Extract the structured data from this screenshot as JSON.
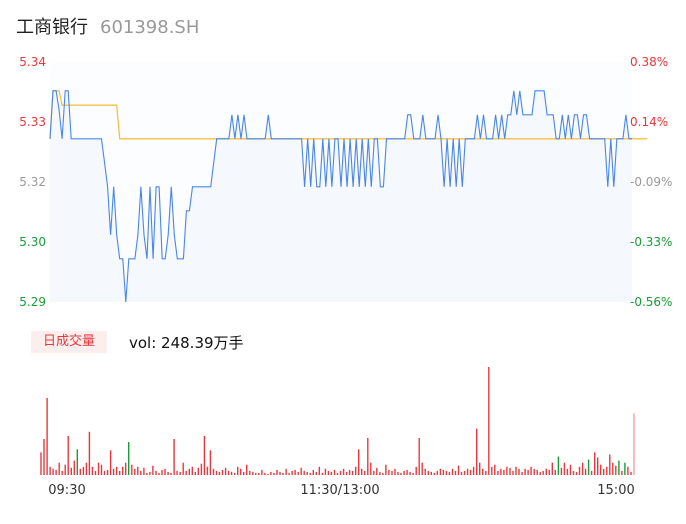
{
  "header": {
    "name": "工商银行",
    "code": "601398.SH"
  },
  "volume_panel": {
    "badge": "日成交量",
    "vol_label": "vol: 248.39万手"
  },
  "colors": {
    "up": "#e8383d",
    "down": "#1a9b3a",
    "neutral": "#999999",
    "price_line": "#4a86e8",
    "avg_line": "#f5c04a",
    "area_fill": "#f5f8fd"
  },
  "chart_data": [
    {
      "type": "line",
      "y_left_ticks": [
        "5.34",
        "5.33",
        "5.32",
        "5.30",
        "5.29"
      ],
      "y_right_ticks": [
        "0.38%",
        "0.14%",
        "-0.09%",
        "-0.33%",
        "-0.56%"
      ],
      "ylim": [
        5.29,
        5.34
      ],
      "x_ticks": [
        "09:30",
        "11:30/13:00",
        "15:00"
      ],
      "prev_close": 5.324,
      "series": [
        {
          "values": [
            5.324,
            5.334,
            5.334,
            5.33,
            5.324,
            5.334,
            5.334,
            5.324,
            5.324,
            5.324,
            5.324,
            5.324,
            5.324,
            5.324,
            5.324,
            5.324,
            5.324,
            5.324,
            5.319,
            5.314,
            5.304,
            5.314,
            5.304,
            5.299,
            5.299,
            5.29,
            5.299,
            5.299,
            5.299,
            5.304,
            5.314,
            5.304,
            5.299,
            5.314,
            5.299,
            5.314,
            5.314,
            5.299,
            5.299,
            5.304,
            5.314,
            5.304,
            5.299,
            5.299,
            5.299,
            5.309,
            5.309,
            5.314,
            5.314,
            5.314,
            5.314,
            5.314,
            5.314,
            5.314,
            5.319,
            5.324,
            5.324,
            5.324,
            5.324,
            5.324,
            5.329,
            5.324,
            5.329,
            5.324,
            5.329,
            5.324,
            5.324,
            5.324,
            5.324,
            5.324,
            5.324,
            5.324,
            5.329,
            5.324,
            5.324,
            5.324,
            5.324,
            5.324,
            5.324,
            5.324,
            5.324,
            5.324,
            5.324,
            5.324,
            5.314,
            5.324,
            5.314,
            5.324,
            5.314,
            5.314,
            5.324,
            5.314,
            5.324,
            5.314,
            5.324,
            5.324,
            5.314,
            5.324,
            5.314,
            5.324,
            5.314,
            5.324,
            5.314,
            5.324,
            5.314,
            5.324,
            5.314,
            5.324,
            5.324,
            5.314,
            5.314,
            5.324,
            5.324,
            5.324,
            5.324,
            5.324,
            5.324,
            5.324,
            5.329,
            5.329,
            5.324,
            5.324,
            5.324,
            5.329,
            5.324,
            5.324,
            5.324,
            5.324,
            5.329,
            5.324,
            5.314,
            5.324,
            5.314,
            5.324,
            5.314,
            5.324,
            5.314,
            5.324,
            5.324,
            5.324,
            5.324,
            5.329,
            5.324,
            5.329,
            5.324,
            5.324,
            5.324,
            5.329,
            5.324,
            5.329,
            5.324,
            5.329,
            5.329,
            5.334,
            5.329,
            5.334,
            5.329,
            5.329,
            5.329,
            5.329,
            5.334,
            5.334,
            5.334,
            5.334,
            5.329,
            5.329,
            5.329,
            5.324,
            5.324,
            5.329,
            5.324,
            5.329,
            5.324,
            5.329,
            5.329,
            5.324,
            5.329,
            5.329,
            5.324,
            5.324,
            5.324,
            5.324,
            5.324,
            5.324,
            5.314,
            5.324,
            5.314,
            5.324,
            5.324,
            5.324,
            5.329,
            5.324,
            5.324
          ]
        },
        {
          "values": [
            5.324,
            5.334,
            5.334,
            5.334,
            5.331,
            5.331,
            5.331,
            5.331,
            5.331,
            5.331,
            5.331,
            5.331,
            5.331,
            5.331,
            5.331,
            5.331,
            5.331,
            5.331,
            5.331,
            5.331,
            5.331,
            5.331,
            5.331,
            5.324,
            5.324,
            5.324,
            5.324,
            5.324,
            5.324,
            5.324,
            5.324,
            5.324,
            5.324,
            5.324,
            5.324,
            5.324,
            5.324,
            5.324,
            5.324,
            5.324,
            5.324,
            5.324,
            5.324,
            5.324,
            5.324,
            5.324,
            5.324,
            5.324,
            5.324,
            5.324,
            5.324,
            5.324,
            5.324,
            5.324,
            5.324,
            5.324,
            5.324,
            5.324,
            5.324,
            5.324,
            5.324,
            5.324,
            5.324,
            5.324,
            5.324,
            5.324,
            5.324,
            5.324,
            5.324,
            5.324,
            5.324,
            5.324,
            5.324,
            5.324,
            5.324,
            5.324,
            5.324,
            5.324,
            5.324,
            5.324,
            5.324,
            5.324,
            5.324,
            5.324,
            5.324,
            5.324,
            5.324,
            5.324,
            5.324,
            5.324,
            5.324,
            5.324,
            5.324,
            5.324,
            5.324,
            5.324,
            5.324,
            5.324,
            5.324,
            5.324,
            5.324,
            5.324,
            5.324,
            5.324,
            5.324,
            5.324,
            5.324,
            5.324,
            5.324,
            5.324,
            5.324,
            5.324,
            5.324,
            5.324,
            5.324,
            5.324,
            5.324,
            5.324,
            5.324,
            5.324,
            5.324,
            5.324,
            5.324,
            5.324,
            5.324,
            5.324,
            5.324,
            5.324,
            5.324,
            5.324,
            5.324,
            5.324,
            5.324,
            5.324,
            5.324,
            5.324,
            5.324,
            5.324,
            5.324,
            5.324,
            5.324,
            5.324,
            5.324,
            5.324,
            5.324,
            5.324,
            5.324,
            5.324,
            5.324,
            5.324,
            5.324,
            5.324,
            5.324,
            5.324,
            5.324,
            5.324,
            5.324,
            5.324,
            5.324,
            5.324,
            5.324,
            5.324,
            5.324,
            5.324,
            5.324,
            5.324,
            5.324,
            5.324,
            5.324,
            5.324,
            5.324,
            5.324,
            5.324,
            5.324,
            5.324,
            5.324,
            5.324,
            5.324,
            5.324,
            5.324,
            5.324,
            5.324,
            5.324,
            5.324,
            5.324,
            5.324,
            5.324,
            5.324,
            5.324,
            5.324,
            5.324,
            5.324,
            5.324,
            5.324,
            5.324,
            5.324,
            5.324,
            5.324
          ]
        }
      ]
    },
    {
      "type": "bar",
      "series": [
        {
          "values": [
            22,
            35,
            75,
            8,
            6,
            5,
            12,
            4,
            10,
            38,
            7,
            14,
            34,
            6,
            8,
            12,
            42,
            8,
            4,
            12,
            10,
            4,
            5,
            24,
            6,
            8,
            4,
            8,
            12,
            14,
            10,
            6,
            8,
            4,
            7,
            2,
            3,
            9,
            4,
            2,
            5,
            6,
            3,
            2,
            35,
            4,
            3,
            12,
            4,
            6,
            8,
            3,
            7,
            11,
            38,
            8,
            24,
            6,
            4,
            3,
            5,
            7,
            4,
            3,
            2,
            8,
            6,
            3,
            10,
            4,
            3,
            2,
            2,
            5,
            2,
            1,
            3,
            2,
            5,
            3,
            2,
            6,
            2,
            4,
            5,
            3,
            7,
            4,
            3,
            2,
            5,
            3,
            8,
            2,
            6,
            4,
            3,
            5,
            2,
            4,
            6,
            3,
            5,
            4,
            8,
            25,
            6,
            4,
            36,
            12,
            4,
            7,
            3,
            2,
            10,
            5,
            4,
            6,
            3,
            2,
            4,
            5,
            3,
            2,
            8,
            36,
            12,
            6,
            4,
            3,
            2,
            4,
            6,
            5,
            4,
            3,
            6,
            4,
            9,
            3,
            4,
            6,
            5,
            8,
            45,
            12,
            6,
            4,
            105,
            8,
            10,
            4,
            6,
            5,
            8,
            7,
            4,
            8,
            6,
            3,
            6,
            5,
            8,
            6,
            5,
            3,
            4,
            6,
            5,
            12,
            5,
            15,
            7,
            12,
            6,
            10,
            4,
            3,
            8,
            12,
            6,
            15,
            4,
            22,
            17,
            10,
            6,
            8,
            20,
            12,
            9,
            16,
            4,
            11,
            8,
            3,
            60
          ]
        },
        {
          "values": [
            2,
            3,
            5,
            1,
            1,
            1,
            2,
            1,
            2,
            5,
            1,
            2,
            25,
            1,
            1,
            2,
            3,
            1,
            1,
            2,
            2,
            1,
            1,
            3,
            1,
            1,
            1,
            2,
            2,
            32,
            2,
            1,
            2,
            1,
            1,
            1,
            1,
            2,
            1,
            1,
            1,
            1,
            1,
            1,
            3,
            1,
            1,
            6,
            1,
            1,
            2,
            1,
            1,
            2,
            3,
            2,
            4,
            1,
            1,
            1,
            1,
            2,
            1,
            1,
            1,
            2,
            1,
            1,
            2,
            1,
            1,
            1,
            1,
            1,
            1,
            1,
            1,
            1,
            1,
            1,
            1,
            1,
            1,
            1,
            1,
            1,
            1,
            1,
            1,
            1,
            1,
            1,
            1,
            1,
            1,
            1,
            1,
            1,
            1,
            1,
            1,
            1,
            1,
            1,
            2,
            3,
            1,
            1,
            4,
            2,
            1,
            1,
            1,
            1,
            2,
            1,
            1,
            1,
            1,
            1,
            1,
            1,
            1,
            1,
            1,
            3,
            2,
            1,
            1,
            1,
            1,
            1,
            1,
            1,
            1,
            1,
            1,
            1,
            2,
            1,
            1,
            1,
            1,
            2,
            4,
            2,
            1,
            1,
            8,
            2,
            2,
            1,
            1,
            1,
            2,
            1,
            1,
            1,
            1,
            1,
            1,
            1,
            1,
            1,
            1,
            1,
            1,
            1,
            1,
            2,
            1,
            18,
            1,
            2,
            1,
            2,
            1,
            1,
            1,
            2,
            1,
            15,
            1,
            3,
            2,
            2,
            1,
            1,
            3,
            2,
            2,
            14,
            1,
            12,
            2,
            1,
            20
          ]
        }
      ]
    }
  ]
}
